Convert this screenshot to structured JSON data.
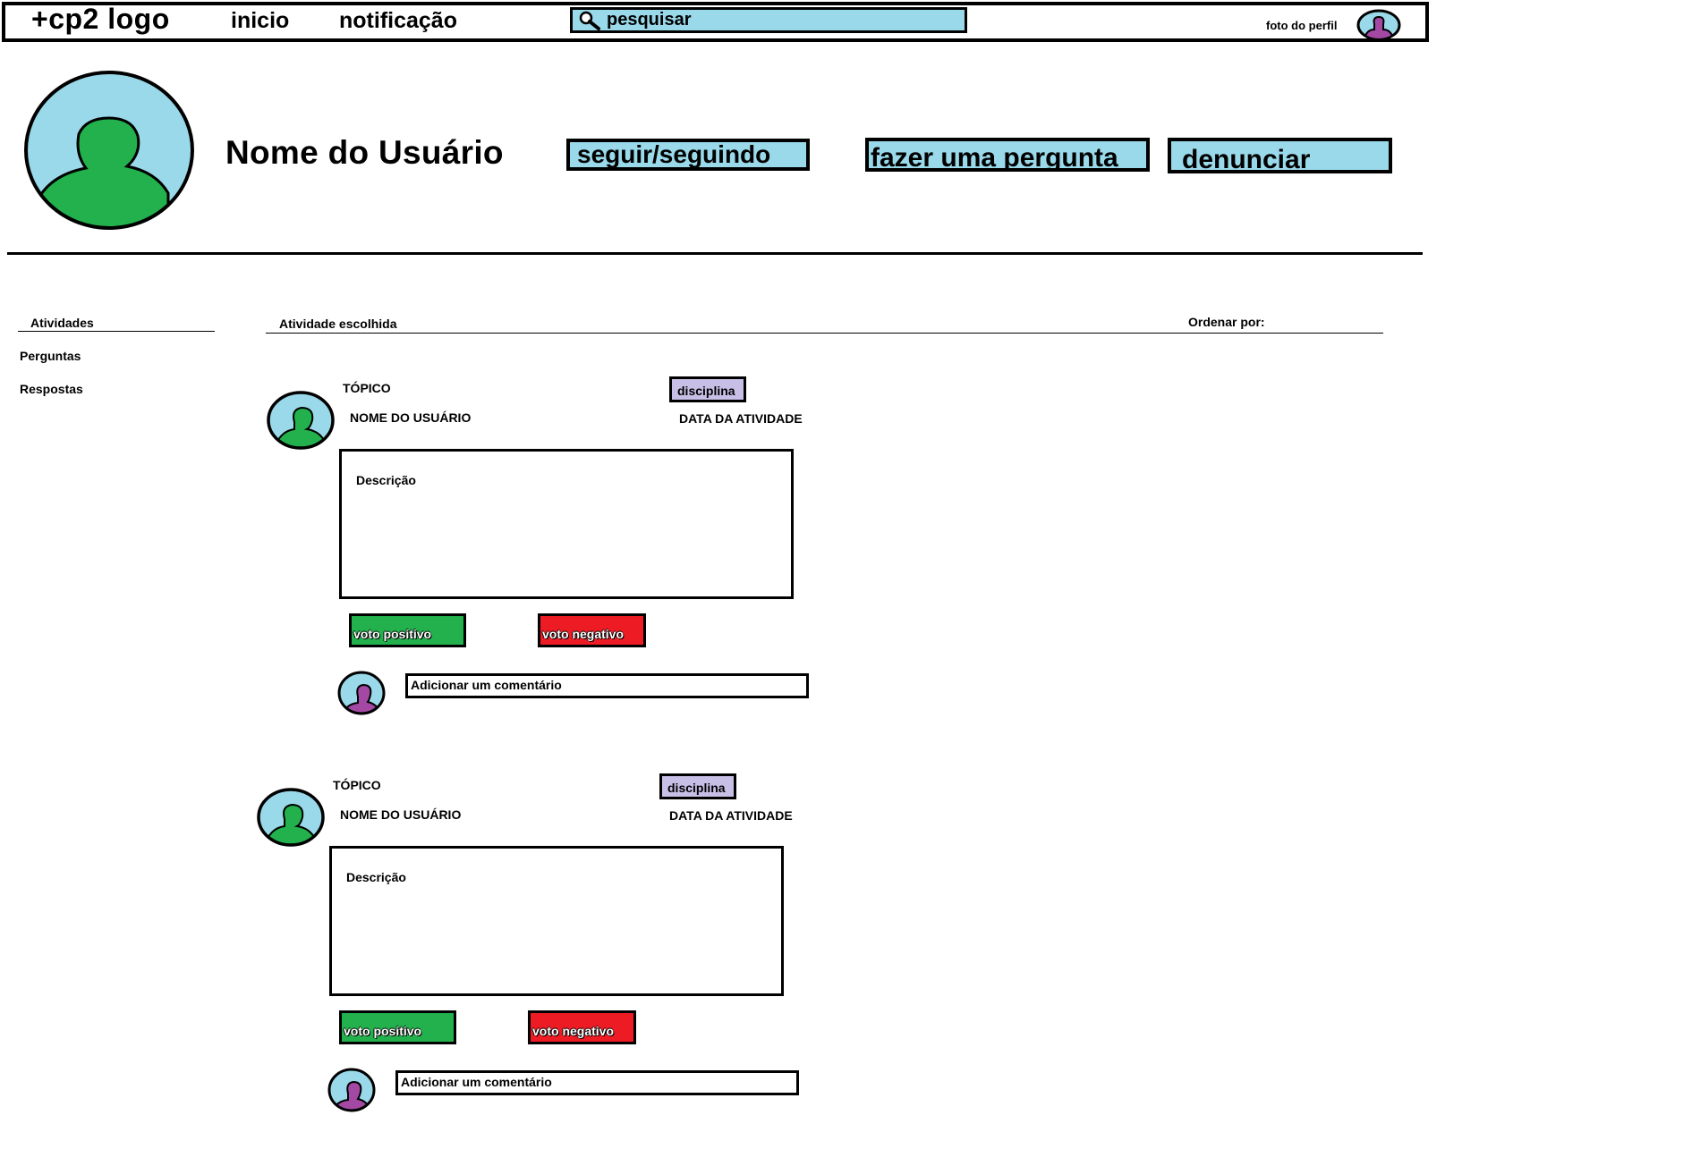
{
  "topbar": {
    "logo": "+cp2 logo",
    "nav": [
      "inicio",
      "notificação"
    ],
    "search_placeholder": "pesquisar",
    "profile_label": "foto do perfil"
  },
  "profile": {
    "name": "Nome do Usuário",
    "buttons": {
      "follow": "seguir/seguindo",
      "ask": "fazer uma pergunta",
      "report": "denunciar"
    }
  },
  "sidebar": {
    "title": "Atividades",
    "items": [
      "Perguntas",
      "Respostas"
    ]
  },
  "main": {
    "title": "Atividade escolhida",
    "order_label": "Ordenar por:"
  },
  "posts": [
    {
      "topic": "TÓPICO",
      "user": "NOME DO USUÁRIO",
      "discipline": "disciplina",
      "date": "DATA DA ATIVIDADE",
      "description": "Descrição",
      "upvote": "voto positivo",
      "downvote": "voto negativo",
      "comment_placeholder": "Adicionar um comentário"
    },
    {
      "topic": "TÓPICO",
      "user": "NOME DO USUÁRIO",
      "discipline": "disciplina",
      "date": "DATA DA ATIVIDADE",
      "description": "Descrição",
      "upvote": "voto positivo",
      "downvote": "voto negativo",
      "comment_placeholder": "Adicionar um comentário"
    }
  ],
  "colors": {
    "accent_blue": "#99d9ea",
    "avatar_green": "#22b14c",
    "avatar_purple": "#a349a4",
    "discipline_lavender": "#c8bfe7",
    "upvote_green": "#22b14c",
    "downvote_red": "#ed1c24"
  },
  "icons": {
    "search": "magnifier-icon",
    "avatar": "user-silhouette-icon"
  }
}
